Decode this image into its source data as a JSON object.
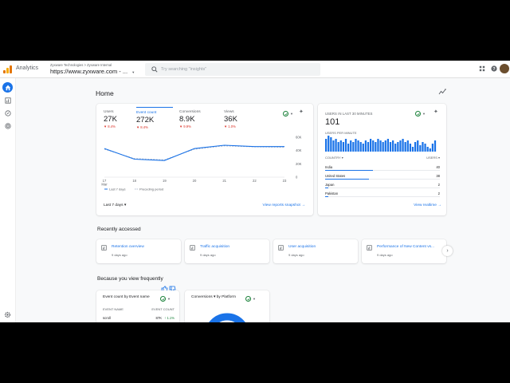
{
  "topbar": {
    "app_name": "Analytics",
    "account_path": "Zyxware Technologies > Zyxware Internal",
    "property_name": "https://www.zyxware.com - ...",
    "search_placeholder": "Try searching \"insights\""
  },
  "page": {
    "title": "Home"
  },
  "overview": {
    "metrics": [
      {
        "label": "Users",
        "value": "27K",
        "change": "▼ 8.4%"
      },
      {
        "label": "Event count",
        "value": "272K",
        "change": "▼ 8.4%",
        "active": true
      },
      {
        "label": "Conversions",
        "value": "8.9K",
        "change": "▼ 9.9%"
      },
      {
        "label": "Views",
        "value": "36K",
        "change": "▼ 1.0%"
      }
    ],
    "date_range": "Last 7 days ▾",
    "snapshot_link": "View reports snapshot →",
    "legend_current": "Last 7 days",
    "legend_previous": "Preceding period"
  },
  "chart_data": {
    "type": "line",
    "x": [
      "17 Mar",
      "18",
      "19",
      "20",
      "21",
      "22",
      "23"
    ],
    "x_tick_labels": [
      "17",
      "18",
      "19",
      "20",
      "21",
      "22",
      "23"
    ],
    "x_sub_label": "Mar",
    "series": [
      {
        "name": "Last 7 days",
        "values": [
          43000,
          27000,
          25000,
          43000,
          48000,
          46000,
          46000
        ]
      },
      {
        "name": "Preceding period",
        "values": [
          42000,
          28000,
          26000,
          42000,
          47000,
          45500,
          45000
        ]
      }
    ],
    "y_ticks": [
      "60K",
      "40K",
      "20K",
      "0"
    ],
    "ylim": [
      0,
      60000
    ],
    "grid": false,
    "legend_position": "bottom"
  },
  "realtime": {
    "title": "USERS IN LAST 30 MINUTES",
    "value": "101",
    "per_minute_label": "USERS PER MINUTE",
    "per_minute_values": [
      8,
      10,
      9,
      7,
      8,
      6,
      7,
      6,
      8,
      5,
      7,
      6,
      8,
      7,
      6,
      5,
      7,
      6,
      8,
      7,
      6,
      8,
      7,
      6,
      7,
      8,
      6,
      7,
      5,
      6,
      7,
      8,
      6,
      7,
      5,
      3,
      6,
      7,
      4,
      6,
      5,
      3,
      2,
      5,
      7
    ],
    "col_country": "COUNTRY ▾",
    "col_users": "USERS ▾",
    "rows": [
      {
        "country": "India",
        "users": "40",
        "share": 0.42
      },
      {
        "country": "United States",
        "users": "38",
        "share": 0.38
      },
      {
        "country": "Japan",
        "users": "2",
        "share": 0.03
      },
      {
        "country": "Pakistan",
        "users": "2",
        "share": 0.03
      }
    ],
    "link": "View realtime →"
  },
  "recent": {
    "heading": "Recently accessed",
    "items": [
      {
        "name": "Retention overview",
        "time": "9 days ago"
      },
      {
        "name": "Traffic acquisition",
        "time": "9 days ago"
      },
      {
        "name": "User acquisition",
        "time": "9 days ago"
      },
      {
        "name": "Performance of New Content vs...",
        "time": "9 days ago"
      }
    ]
  },
  "frequent": {
    "heading": "Because you view frequently",
    "card1": {
      "title": "Event count by Event name",
      "col1": "EVENT NAME",
      "col2": "EVENT COUNT",
      "row_name": "scroll",
      "row_count": "87K",
      "row_change": "↑ 1.1%"
    },
    "card2": {
      "title": "Conversions ▾ by Platform"
    }
  },
  "colors": {
    "accent": "#1a73e8",
    "negative": "#d93025",
    "ok": "#188038"
  }
}
